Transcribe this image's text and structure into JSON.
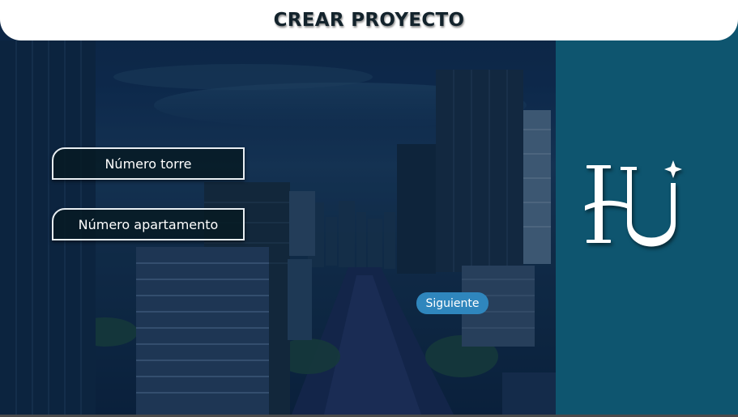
{
  "header": {
    "title": "CREAR PROYECTO"
  },
  "form": {
    "tower_field": {
      "placeholder": "Número torre",
      "value": ""
    },
    "apartment_field": {
      "placeholder": "Número apartamento",
      "value": ""
    },
    "next_button_label": "Siguiente"
  },
  "colors": {
    "header_bg": "#ffffff",
    "panel_bg": "#0e556f",
    "button_bg": "#2f86bd",
    "input_bg": "#061a22"
  },
  "icons": {
    "brand_logo": "hu-monogram-logo"
  }
}
